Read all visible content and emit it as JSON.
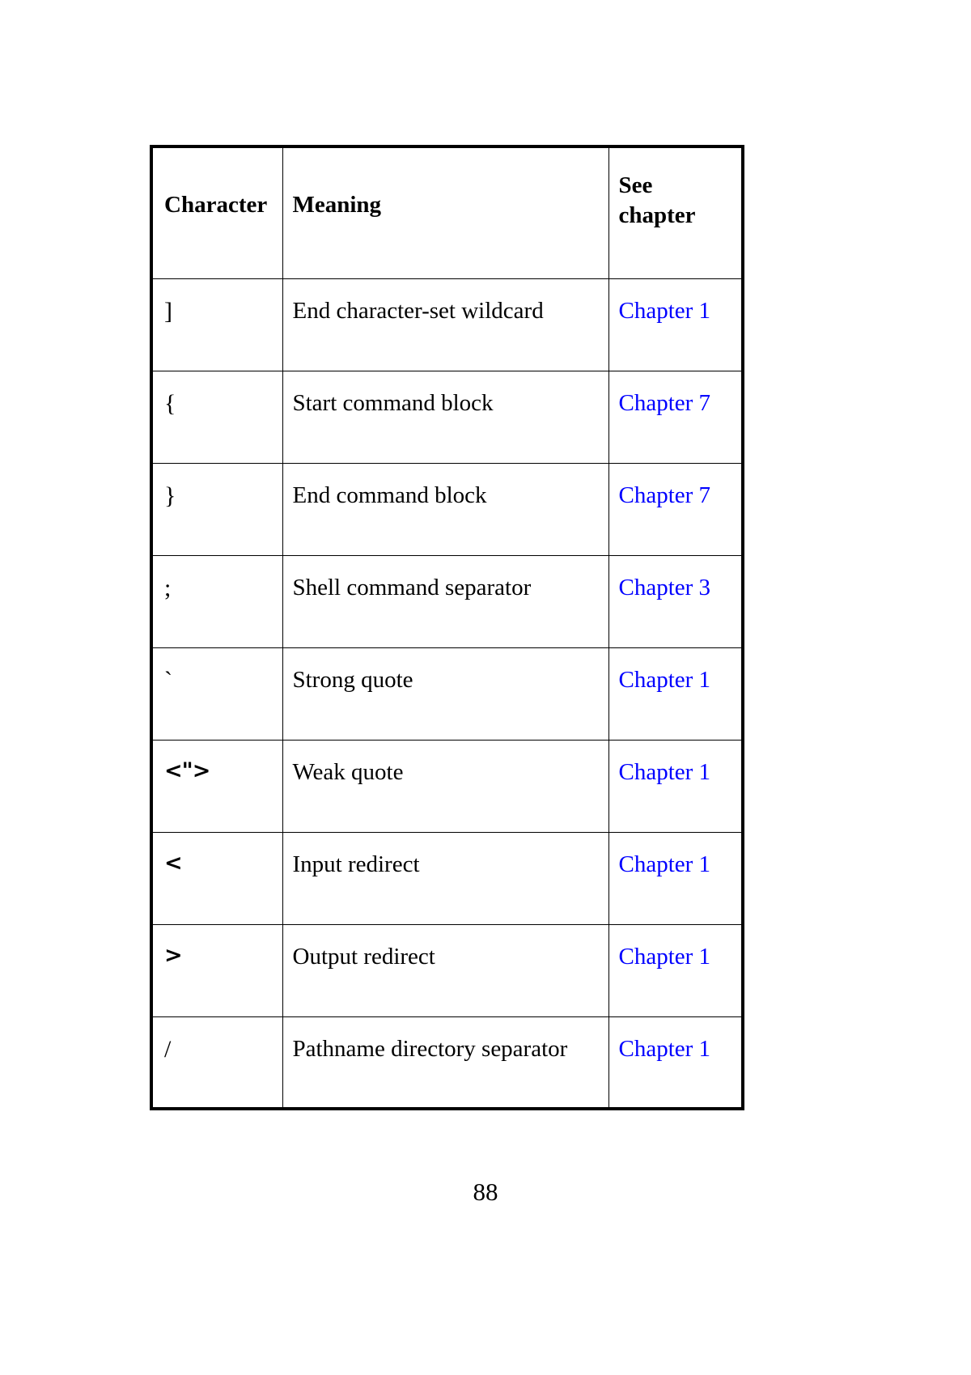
{
  "page": {
    "number": "88"
  },
  "table": {
    "columns": [
      {
        "key": "character",
        "label": "Character"
      },
      {
        "key": "meaning",
        "label": "Meaning"
      },
      {
        "key": "chapter",
        "label_line1": "See",
        "label_line2": "chapter"
      }
    ],
    "rows": [
      {
        "character": "]",
        "meaning": "End character-set wildcard",
        "chapter": "Chapter 1"
      },
      {
        "character": "{",
        "meaning": "Start command block",
        "chapter": "Chapter 7"
      },
      {
        "character": "}",
        "meaning": "End command block",
        "chapter": "Chapter 7"
      },
      {
        "character": ";",
        "meaning": "Shell command separator",
        "chapter": "Chapter 3"
      },
      {
        "character": "`",
        "meaning": "Strong quote",
        "chapter": "Chapter 1"
      },
      {
        "character": "<\">",
        "meaning": "Weak quote",
        "chapter": "Chapter 1"
      },
      {
        "character": "<",
        "meaning": "Input redirect",
        "chapter": "Chapter 1"
      },
      {
        "character": ">",
        "meaning": "Output redirect",
        "chapter": "Chapter 1"
      },
      {
        "character": "/",
        "meaning": "Pathname directory separator",
        "chapter": "Chapter 1"
      }
    ]
  },
  "colors": {
    "link": "#0000ff",
    "text": "#000000",
    "border": "#000000",
    "background": "#ffffff"
  }
}
